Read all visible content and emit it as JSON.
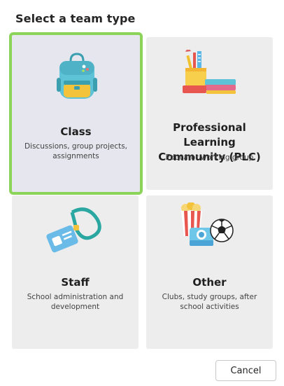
{
  "dialog": {
    "title": "Select a team type",
    "cancel_label": "Cancel"
  },
  "team_types": [
    {
      "title": "Class",
      "description": "Discussions, group projects, assignments",
      "icon": "backpack-icon",
      "selected": true
    },
    {
      "title": "Professional Learning Community (PLC)",
      "description": "Educator working group",
      "icon": "books-and-pencils-icon",
      "selected": false
    },
    {
      "title": "Staff",
      "description": "School administration and development",
      "icon": "id-badge-lanyard-icon",
      "selected": false
    },
    {
      "title": "Other",
      "description": "Clubs, study groups, after school activities",
      "icon": "popcorn-camera-ball-icon",
      "selected": false
    }
  ],
  "colors": {
    "selection_border": "#8cd35a",
    "card_background": "#ededed",
    "selected_card_background": "#e6e6ef"
  }
}
